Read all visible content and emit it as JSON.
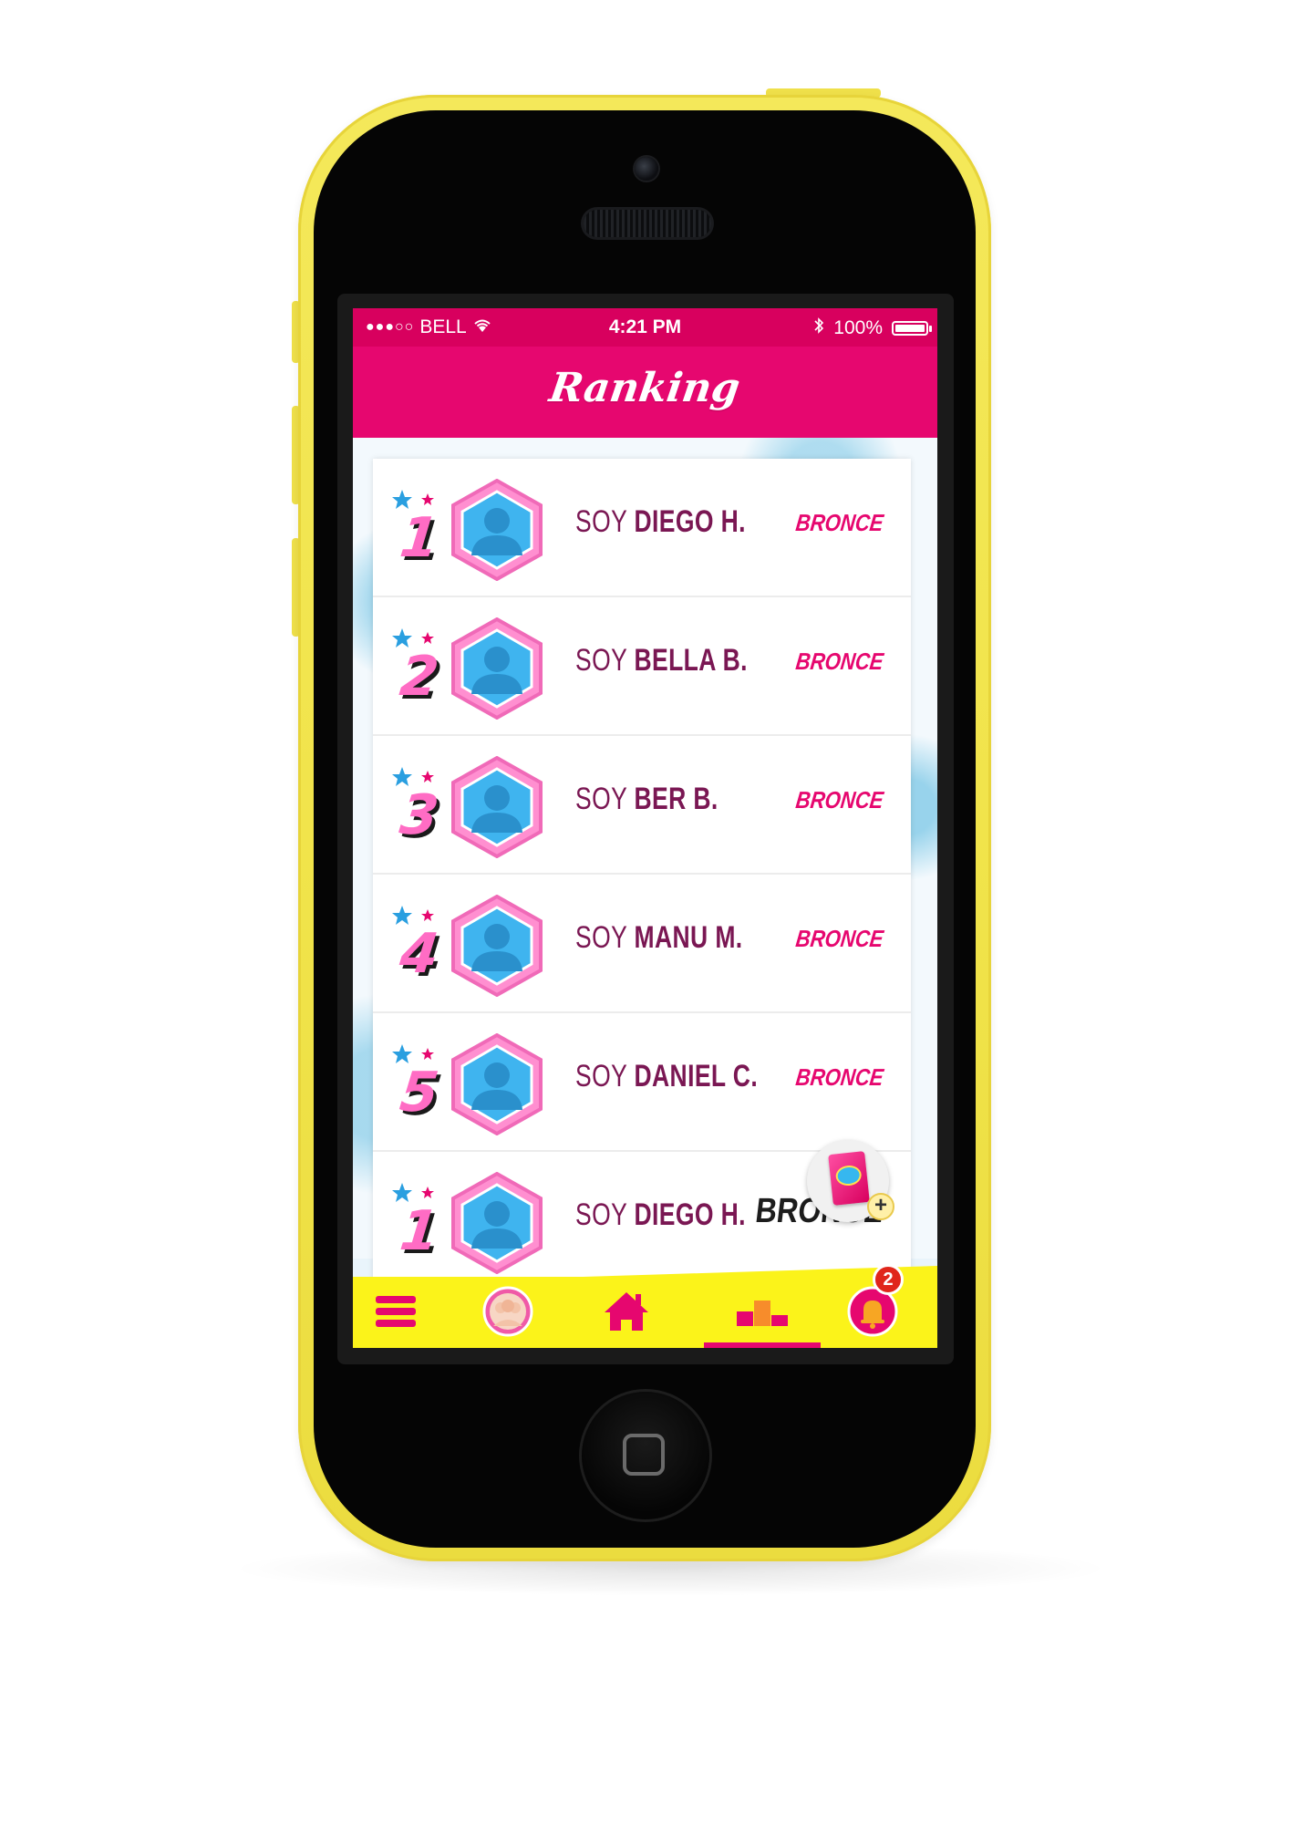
{
  "status_bar": {
    "signal": "●●●○○",
    "carrier": "BELL",
    "time": "4:21 PM",
    "battery": "100%"
  },
  "header": {
    "title": "Ranking"
  },
  "ranking": [
    {
      "rank": "1",
      "soy": "SOY",
      "name": "DIEGO H.",
      "level": "BRONCE"
    },
    {
      "rank": "2",
      "soy": "SOY",
      "name": "BELLA B.",
      "level": "BRONCE"
    },
    {
      "rank": "3",
      "soy": "SOY",
      "name": "BER B.",
      "level": "BRONCE"
    },
    {
      "rank": "4",
      "soy": "SOY",
      "name": "MANU M.",
      "level": "BRONCE"
    },
    {
      "rank": "5",
      "soy": "SOY",
      "name": "DANIEL C.",
      "level": "BRONCE"
    },
    {
      "rank": "1",
      "soy": "SOY",
      "name": "DIEGO H.",
      "level": "BRONCE"
    }
  ],
  "fab": {
    "plus": "+"
  },
  "tabbar": {
    "icons": [
      "menu-icon",
      "friends-icon",
      "home-icon",
      "podium-icon",
      "bell-icon"
    ],
    "active": "podium-icon",
    "notification_count": "2"
  },
  "colors": {
    "primary_pink": "#e6076f",
    "status_pink": "#d8005e",
    "tabbar_yellow": "#fbf31a",
    "phone_yellow": "#f1e44b",
    "avatar_blue": "#3fb4ef"
  }
}
